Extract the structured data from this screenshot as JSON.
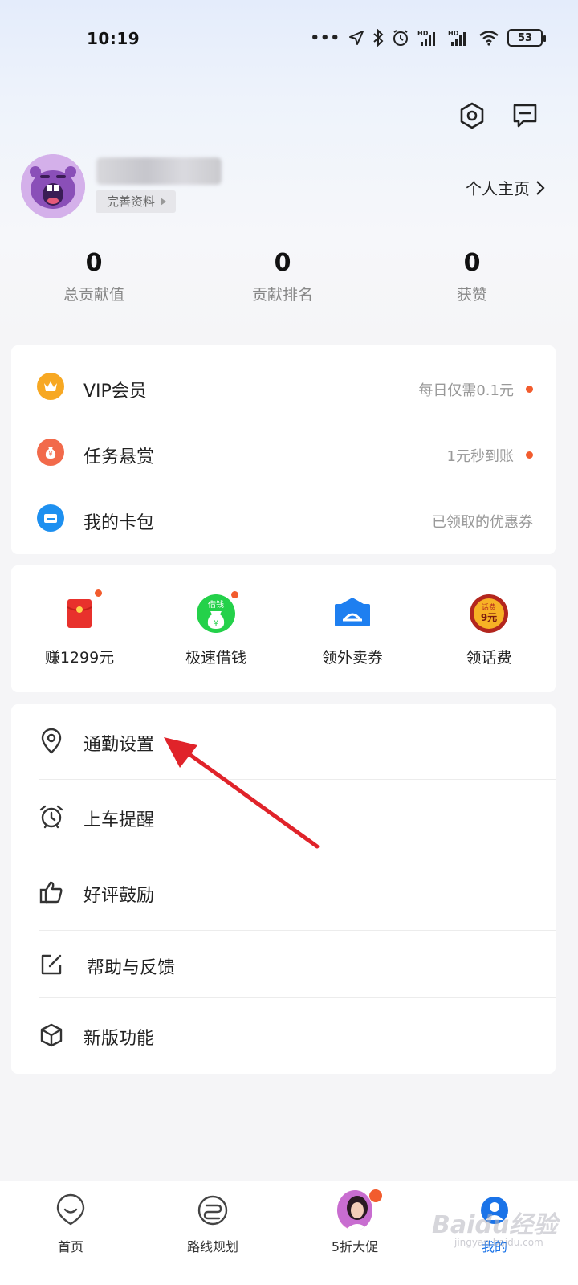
{
  "status_bar": {
    "time": "10:19",
    "battery": "53",
    "icons": [
      "more-dots-icon",
      "location-arrow-icon",
      "bluetooth-icon",
      "alarm-icon",
      "signal-hd-1-icon",
      "signal-hd-2-icon",
      "wifi-icon",
      "battery-icon"
    ],
    "hd_label": "HD"
  },
  "header": {
    "actions": [
      "settings-hexagon-icon",
      "message-icon"
    ]
  },
  "profile": {
    "complete_profile_label": "完善资料",
    "homepage_label": "个人主页"
  },
  "stats": [
    {
      "value": "0",
      "label": "总贡献值"
    },
    {
      "value": "0",
      "label": "贡献排名"
    },
    {
      "value": "0",
      "label": "获赞"
    }
  ],
  "services": [
    {
      "label": "VIP会员",
      "sub": "每日仅需0.1元",
      "icon": "crown-icon",
      "color": "#f7a823",
      "dot": true
    },
    {
      "label": "任务悬赏",
      "sub": "1元秒到账",
      "icon": "money-bag-icon",
      "color": "#f26a4b",
      "dot": true
    },
    {
      "label": "我的卡包",
      "sub": "已领取的优惠券",
      "icon": "card-icon",
      "color": "#1e90f0",
      "dot": false
    }
  ],
  "quick_actions": [
    {
      "label": "赚1299元",
      "icon": "red-packet-icon",
      "dot": true
    },
    {
      "label": "极速借钱",
      "icon": "borrow-money-icon",
      "badge": "借钱",
      "dot": true
    },
    {
      "label": "领外卖券",
      "icon": "takeout-coupon-icon",
      "dot": false
    },
    {
      "label": "领话费",
      "icon": "phone-bill-icon",
      "badge": "话费",
      "amount": "9元",
      "dot": false
    }
  ],
  "menu": [
    {
      "label": "通勤设置",
      "icon": "location-pin-icon"
    },
    {
      "label": "上车提醒",
      "icon": "alarm-clock-icon"
    },
    {
      "label": "好评鼓励",
      "icon": "thumbs-up-icon"
    },
    {
      "label": "帮助与反馈",
      "icon": "edit-feedback-icon"
    },
    {
      "label": "新版功能",
      "icon": "cube-icon"
    }
  ],
  "bottom_nav": [
    {
      "label": "首页",
      "icon": "home-smile-icon"
    },
    {
      "label": "路线规划",
      "icon": "route-icon"
    },
    {
      "label": "5折大促",
      "icon": "promo-avatar-icon"
    },
    {
      "label": "我的",
      "icon": "mine-icon",
      "active": true
    }
  ],
  "watermark": {
    "text": "Baidu经验",
    "sub": "jingyan.baidu.com"
  },
  "colors": {
    "accent": "#1a73e8",
    "dot": "#f25c2e",
    "annotation_arrow": "#e0232a"
  }
}
